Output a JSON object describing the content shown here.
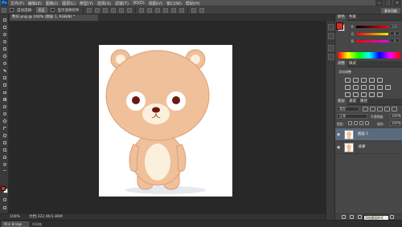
{
  "app": {
    "logo": "Ps"
  },
  "menu": [
    "文件(F)",
    "编辑(E)",
    "图像(I)",
    "图层(L)",
    "类型(Y)",
    "选择(S)",
    "滤镜(T)",
    "3D(D)",
    "视图(V)",
    "窗口(W)",
    "帮助(H)"
  ],
  "window_controls": [
    "—",
    "□",
    "×"
  ],
  "options": {
    "auto_select_label": "自动选择:",
    "auto_select_value": "图层",
    "show_transform_label": "显示变换控件"
  },
  "workspace": {
    "label": "基本功能"
  },
  "document": {
    "tab_title": "熊仔.png @ 100% (图层 1, RGB/8) *",
    "zoom": "100%",
    "doc_size": "文档:322.4K/1.86M"
  },
  "bottom": {
    "mini_bridge": "Mini Bridge",
    "timeline": "时间轴"
  },
  "colors": {
    "foreground": "#e02a1e",
    "background": "#ffffff",
    "accent": "#31a8ff",
    "bear_fur": "#efc09a",
    "bear_inner": "#fbf0dc"
  },
  "color_panel": {
    "tabs": [
      "颜色",
      "色板"
    ],
    "channels": [
      {
        "label": "R",
        "value": "225"
      },
      {
        "label": "G",
        "value": "0"
      },
      {
        "label": "B",
        "value": "0"
      }
    ]
  },
  "adjust_panel": {
    "tabs": [
      "调整",
      "样式"
    ],
    "add_label": "添加调整"
  },
  "layers_panel": {
    "tabs": [
      "图层",
      "通道",
      "路径"
    ],
    "kind_filter": "类型",
    "blend_mode": "正常",
    "opacity_label": "不透明度:",
    "opacity_value": "100%",
    "lock_label": "锁定:",
    "fill_label": "填充:",
    "fill_value": "100%",
    "layers": [
      {
        "name": "图层 1",
        "selected": true
      },
      {
        "name": "背景",
        "selected": false
      }
    ]
  },
  "tooltip": {
    "text": "添加图层样式"
  }
}
